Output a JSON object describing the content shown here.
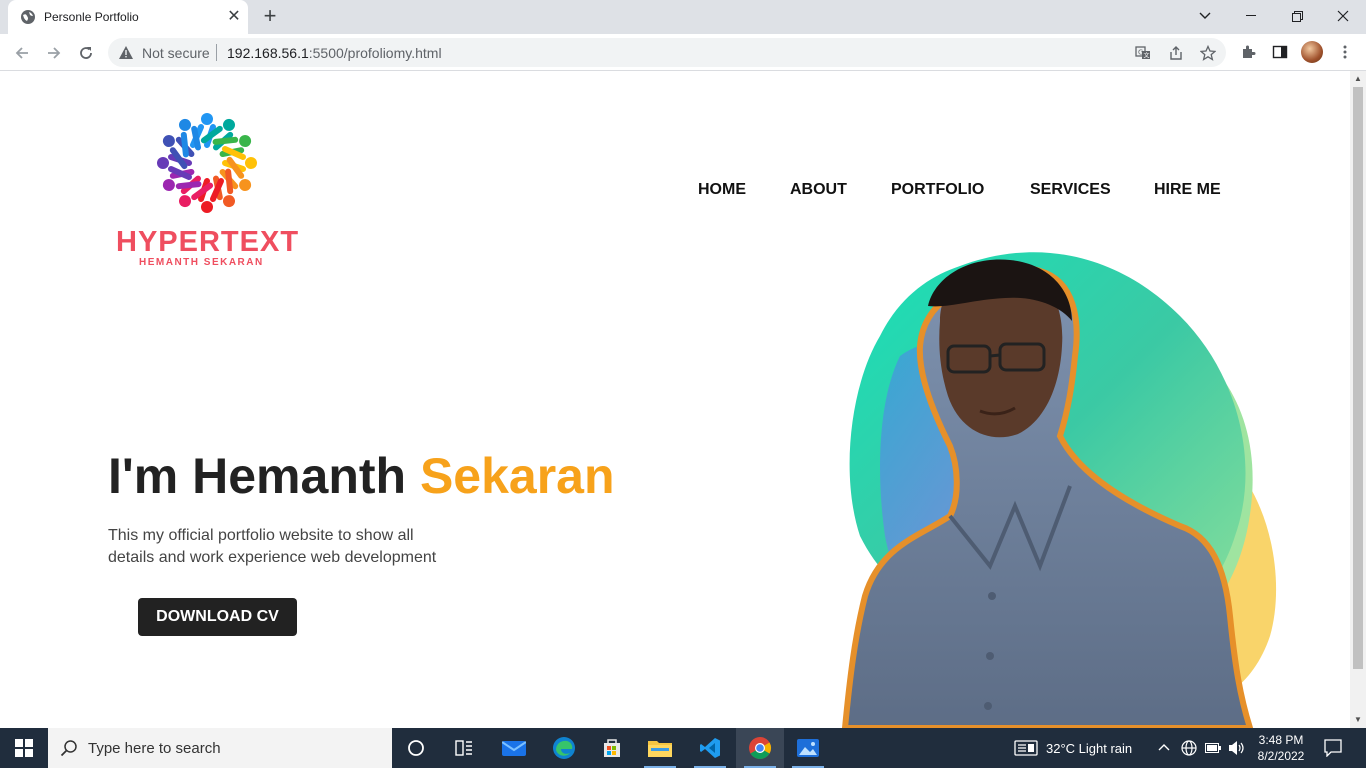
{
  "browser": {
    "tab_title": "Personle Portfolio",
    "security_label": "Not secure",
    "url_host": "192.168.56.1",
    "url_rest": ":5500/profoliomy.html"
  },
  "page": {
    "brand": "HYPERTEXT",
    "brand_sub": "HEMANTH SEKARAN",
    "nav": [
      "HOME",
      "ABOUT",
      "PORTFOLIO",
      "SERVICES",
      "HIRE ME"
    ],
    "hero_prefix": "I'm Hemanth ",
    "hero_accent": "Sekaran",
    "hero_line1": "This my official portfolio website to show all",
    "hero_line2": "details and work experience web development",
    "cv_button": "DOWNLOAD CV"
  },
  "colors": {
    "brand": "#ef4e5f",
    "accent": "#f7a21b",
    "button": "#222222"
  },
  "taskbar": {
    "search_placeholder": "Type here to search",
    "weather": "32°C  Light rain",
    "time": "3:48 PM",
    "date": "8/2/2022",
    "apps": [
      "task-view-icon",
      "widgets-icon",
      "mail-icon",
      "edge-icon",
      "store-icon",
      "file-explorer-icon",
      "vscode-icon",
      "chrome-icon",
      "photos-icon"
    ]
  }
}
